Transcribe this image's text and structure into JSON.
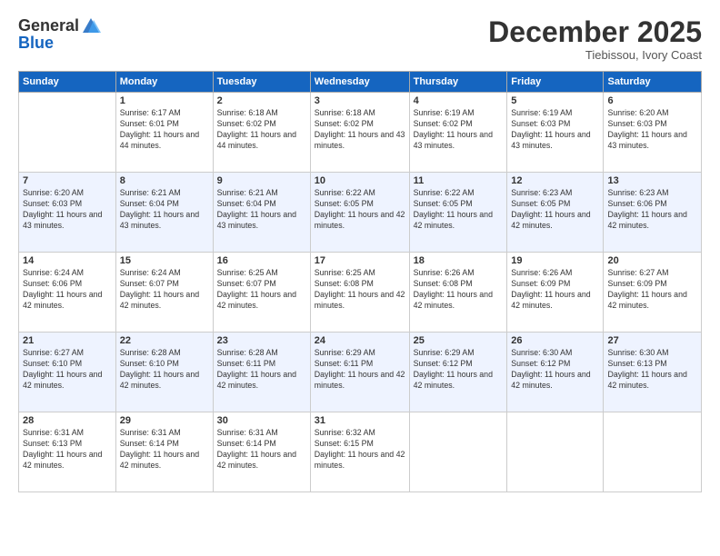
{
  "header": {
    "logo_general": "General",
    "logo_blue": "Blue",
    "month_title": "December 2025",
    "location": "Tiebissou, Ivory Coast"
  },
  "days_of_week": [
    "Sunday",
    "Monday",
    "Tuesday",
    "Wednesday",
    "Thursday",
    "Friday",
    "Saturday"
  ],
  "weeks": [
    [
      {
        "day": "",
        "sunrise": "",
        "sunset": "",
        "daylight": ""
      },
      {
        "day": "1",
        "sunrise": "Sunrise: 6:17 AM",
        "sunset": "Sunset: 6:01 PM",
        "daylight": "Daylight: 11 hours and 44 minutes."
      },
      {
        "day": "2",
        "sunrise": "Sunrise: 6:18 AM",
        "sunset": "Sunset: 6:02 PM",
        "daylight": "Daylight: 11 hours and 44 minutes."
      },
      {
        "day": "3",
        "sunrise": "Sunrise: 6:18 AM",
        "sunset": "Sunset: 6:02 PM",
        "daylight": "Daylight: 11 hours and 43 minutes."
      },
      {
        "day": "4",
        "sunrise": "Sunrise: 6:19 AM",
        "sunset": "Sunset: 6:02 PM",
        "daylight": "Daylight: 11 hours and 43 minutes."
      },
      {
        "day": "5",
        "sunrise": "Sunrise: 6:19 AM",
        "sunset": "Sunset: 6:03 PM",
        "daylight": "Daylight: 11 hours and 43 minutes."
      },
      {
        "day": "6",
        "sunrise": "Sunrise: 6:20 AM",
        "sunset": "Sunset: 6:03 PM",
        "daylight": "Daylight: 11 hours and 43 minutes."
      }
    ],
    [
      {
        "day": "7",
        "sunrise": "Sunrise: 6:20 AM",
        "sunset": "Sunset: 6:03 PM",
        "daylight": "Daylight: 11 hours and 43 minutes."
      },
      {
        "day": "8",
        "sunrise": "Sunrise: 6:21 AM",
        "sunset": "Sunset: 6:04 PM",
        "daylight": "Daylight: 11 hours and 43 minutes."
      },
      {
        "day": "9",
        "sunrise": "Sunrise: 6:21 AM",
        "sunset": "Sunset: 6:04 PM",
        "daylight": "Daylight: 11 hours and 43 minutes."
      },
      {
        "day": "10",
        "sunrise": "Sunrise: 6:22 AM",
        "sunset": "Sunset: 6:05 PM",
        "daylight": "Daylight: 11 hours and 42 minutes."
      },
      {
        "day": "11",
        "sunrise": "Sunrise: 6:22 AM",
        "sunset": "Sunset: 6:05 PM",
        "daylight": "Daylight: 11 hours and 42 minutes."
      },
      {
        "day": "12",
        "sunrise": "Sunrise: 6:23 AM",
        "sunset": "Sunset: 6:05 PM",
        "daylight": "Daylight: 11 hours and 42 minutes."
      },
      {
        "day": "13",
        "sunrise": "Sunrise: 6:23 AM",
        "sunset": "Sunset: 6:06 PM",
        "daylight": "Daylight: 11 hours and 42 minutes."
      }
    ],
    [
      {
        "day": "14",
        "sunrise": "Sunrise: 6:24 AM",
        "sunset": "Sunset: 6:06 PM",
        "daylight": "Daylight: 11 hours and 42 minutes."
      },
      {
        "day": "15",
        "sunrise": "Sunrise: 6:24 AM",
        "sunset": "Sunset: 6:07 PM",
        "daylight": "Daylight: 11 hours and 42 minutes."
      },
      {
        "day": "16",
        "sunrise": "Sunrise: 6:25 AM",
        "sunset": "Sunset: 6:07 PM",
        "daylight": "Daylight: 11 hours and 42 minutes."
      },
      {
        "day": "17",
        "sunrise": "Sunrise: 6:25 AM",
        "sunset": "Sunset: 6:08 PM",
        "daylight": "Daylight: 11 hours and 42 minutes."
      },
      {
        "day": "18",
        "sunrise": "Sunrise: 6:26 AM",
        "sunset": "Sunset: 6:08 PM",
        "daylight": "Daylight: 11 hours and 42 minutes."
      },
      {
        "day": "19",
        "sunrise": "Sunrise: 6:26 AM",
        "sunset": "Sunset: 6:09 PM",
        "daylight": "Daylight: 11 hours and 42 minutes."
      },
      {
        "day": "20",
        "sunrise": "Sunrise: 6:27 AM",
        "sunset": "Sunset: 6:09 PM",
        "daylight": "Daylight: 11 hours and 42 minutes."
      }
    ],
    [
      {
        "day": "21",
        "sunrise": "Sunrise: 6:27 AM",
        "sunset": "Sunset: 6:10 PM",
        "daylight": "Daylight: 11 hours and 42 minutes."
      },
      {
        "day": "22",
        "sunrise": "Sunrise: 6:28 AM",
        "sunset": "Sunset: 6:10 PM",
        "daylight": "Daylight: 11 hours and 42 minutes."
      },
      {
        "day": "23",
        "sunrise": "Sunrise: 6:28 AM",
        "sunset": "Sunset: 6:11 PM",
        "daylight": "Daylight: 11 hours and 42 minutes."
      },
      {
        "day": "24",
        "sunrise": "Sunrise: 6:29 AM",
        "sunset": "Sunset: 6:11 PM",
        "daylight": "Daylight: 11 hours and 42 minutes."
      },
      {
        "day": "25",
        "sunrise": "Sunrise: 6:29 AM",
        "sunset": "Sunset: 6:12 PM",
        "daylight": "Daylight: 11 hours and 42 minutes."
      },
      {
        "day": "26",
        "sunrise": "Sunrise: 6:30 AM",
        "sunset": "Sunset: 6:12 PM",
        "daylight": "Daylight: 11 hours and 42 minutes."
      },
      {
        "day": "27",
        "sunrise": "Sunrise: 6:30 AM",
        "sunset": "Sunset: 6:13 PM",
        "daylight": "Daylight: 11 hours and 42 minutes."
      }
    ],
    [
      {
        "day": "28",
        "sunrise": "Sunrise: 6:31 AM",
        "sunset": "Sunset: 6:13 PM",
        "daylight": "Daylight: 11 hours and 42 minutes."
      },
      {
        "day": "29",
        "sunrise": "Sunrise: 6:31 AM",
        "sunset": "Sunset: 6:14 PM",
        "daylight": "Daylight: 11 hours and 42 minutes."
      },
      {
        "day": "30",
        "sunrise": "Sunrise: 6:31 AM",
        "sunset": "Sunset: 6:14 PM",
        "daylight": "Daylight: 11 hours and 42 minutes."
      },
      {
        "day": "31",
        "sunrise": "Sunrise: 6:32 AM",
        "sunset": "Sunset: 6:15 PM",
        "daylight": "Daylight: 11 hours and 42 minutes."
      },
      {
        "day": "",
        "sunrise": "",
        "sunset": "",
        "daylight": ""
      },
      {
        "day": "",
        "sunrise": "",
        "sunset": "",
        "daylight": ""
      },
      {
        "day": "",
        "sunrise": "",
        "sunset": "",
        "daylight": ""
      }
    ]
  ]
}
